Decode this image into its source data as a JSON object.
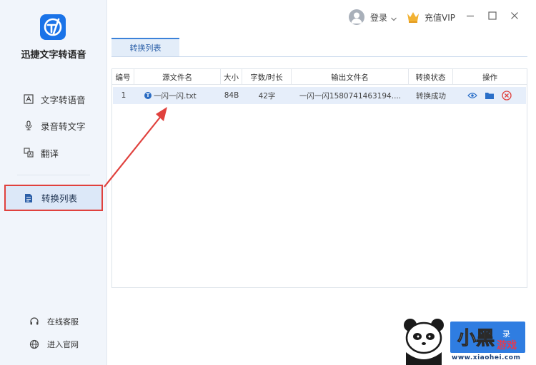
{
  "app": {
    "name": "迅捷文字转语音"
  },
  "sidebar": {
    "items": [
      {
        "label": "文字转语音",
        "icon": "text-box-icon"
      },
      {
        "label": "录音转文字",
        "icon": "microphone-icon"
      },
      {
        "label": "翻译",
        "icon": "translate-icon"
      }
    ],
    "active": {
      "label": "转换列表",
      "icon": "file-list-icon"
    },
    "footer": [
      {
        "label": "在线客服",
        "icon": "headset-icon"
      },
      {
        "label": "进入官网",
        "icon": "globe-icon"
      }
    ]
  },
  "header": {
    "login_label": "登录",
    "vip_label": "充值VIP"
  },
  "tab": {
    "label": "转换列表"
  },
  "table": {
    "columns": [
      "编号",
      "源文件名",
      "大小",
      "字数/时长",
      "输出文件名",
      "转换状态",
      "操作"
    ],
    "rows": [
      {
        "index": "1",
        "source_icon": "T",
        "source": "一闪一闪.txt",
        "size": "84B",
        "count": "42字",
        "output": "一闪一闪1580741463194....",
        "status": "转换成功"
      }
    ]
  },
  "watermark": {
    "record": "录",
    "site": "小黑",
    "game": "游戏",
    "url": "www.xiaohei.com"
  },
  "colors": {
    "accent": "#1a73e8",
    "highlight_border": "#e0413d",
    "vip_gold": "#f2b233",
    "delete_red": "#e0413d"
  }
}
